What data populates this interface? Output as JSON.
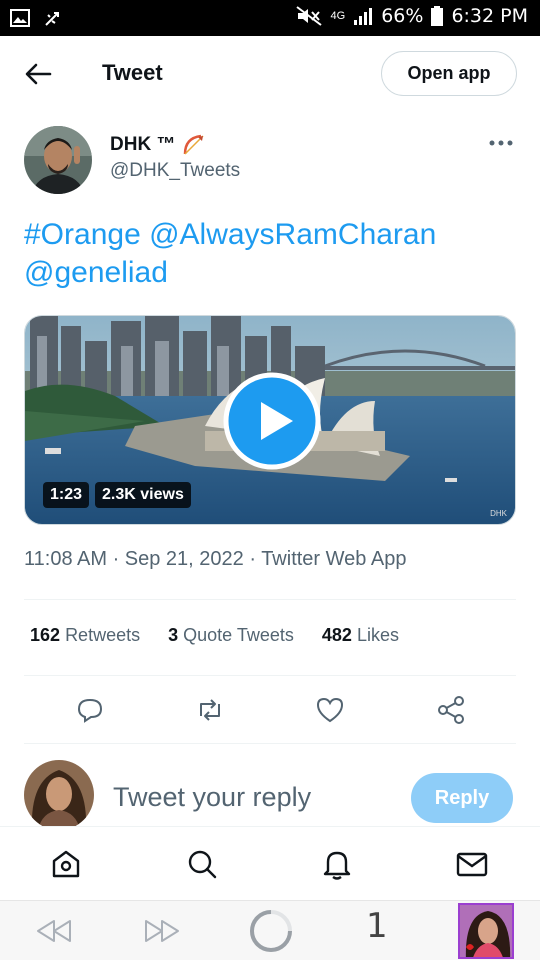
{
  "status_bar": {
    "signal_type": "4G",
    "battery": "66%",
    "time": "6:32 PM"
  },
  "header": {
    "title": "Tweet",
    "open_app_label": "Open app"
  },
  "author": {
    "name": "DHK ™",
    "handle": "@DHK_Tweets"
  },
  "tweet": {
    "line1": "#Orange @AlwaysRamCharan",
    "line2": "@geneliad",
    "video_duration": "1:23",
    "video_views": "2.3K views",
    "video_watermark": "DHK",
    "timestamp": "11:08 AM · Sep 21, 2022 · Twitter Web App"
  },
  "stats": {
    "retweets_count": "162",
    "retweets_label": "Retweets",
    "quotes_count": "3",
    "quotes_label": "Quote Tweets",
    "likes_count": "482",
    "likes_label": "Likes"
  },
  "reply": {
    "placeholder": "Tweet your reply",
    "button_label": "Reply"
  },
  "browser": {
    "tab_count": "1"
  },
  "colors": {
    "accent": "#1d9bf0",
    "reply_disabled": "#8ecdf8",
    "muted_text": "#536471"
  },
  "icons": {
    "back": "arrow-left-icon",
    "more": "more-horizontal-icon",
    "reply": "comment-icon",
    "retweet": "retweet-icon",
    "like": "heart-icon",
    "share": "share-icon",
    "home": "home-icon",
    "search": "search-icon",
    "notifications": "bell-icon",
    "messages": "mail-icon"
  }
}
